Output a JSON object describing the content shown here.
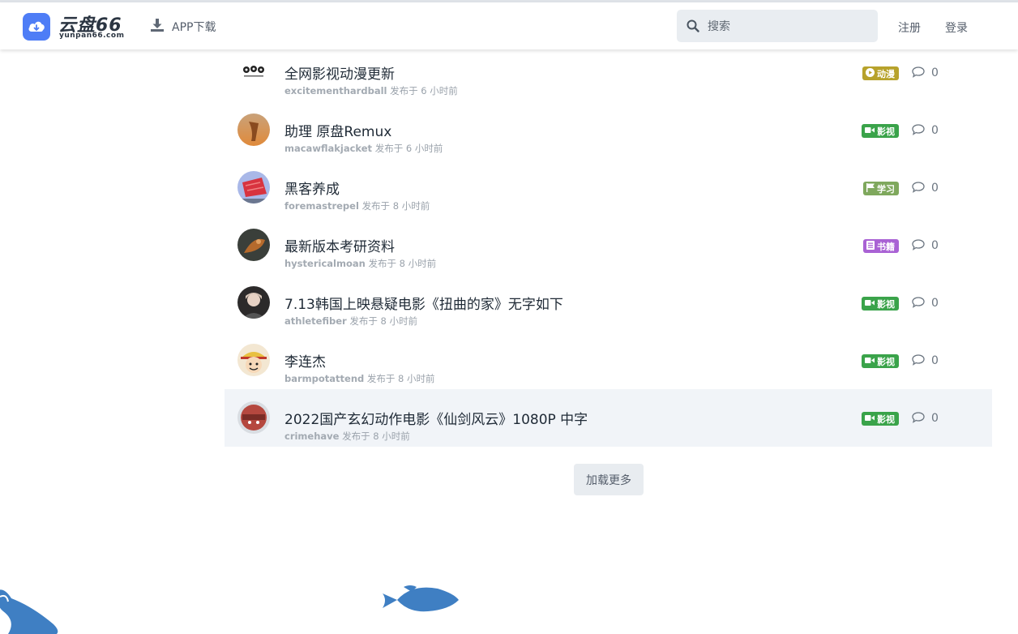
{
  "header": {
    "logo_main": "云盘66",
    "logo_sub": "yunpan66.com",
    "app_download": "APP下载",
    "search_placeholder": "搜索",
    "register": "注册",
    "login": "登录"
  },
  "posts": [
    {
      "title": "全网影视动漫更新",
      "user": "excitementhardball",
      "time": "发布于 6 小时前",
      "tag": "动漫",
      "tag_color": "#b7a22b",
      "tag_icon": "play-circle-icon",
      "comments": "0"
    },
    {
      "title": "助理 原盘Remux",
      "user": "macawflakjacket",
      "time": "发布于 6 小时前",
      "tag": "影视",
      "tag_color": "#3aa34a",
      "tag_icon": "video-camera-icon",
      "comments": "0"
    },
    {
      "title": "黑客养成",
      "user": "foremastrepel",
      "time": "发布于 8 小时前",
      "tag": "学习",
      "tag_color": "#7fa85d",
      "tag_icon": "flag-icon",
      "comments": "0"
    },
    {
      "title": "最新版本考研资料",
      "user": "hystericalmoan",
      "time": "发布于 8 小时前",
      "tag": "书籍",
      "tag_color": "#a962d4",
      "tag_icon": "book-icon",
      "comments": "0"
    },
    {
      "title": "7.13韩国上映悬疑电影《扭曲的家》无字如下",
      "user": "athletefiber",
      "time": "发布于 8 小时前",
      "tag": "影视",
      "tag_color": "#3aa34a",
      "tag_icon": "video-camera-icon",
      "comments": "0"
    },
    {
      "title": "李连杰",
      "user": "barmpotattend",
      "time": "发布于 8 小时前",
      "tag": "影视",
      "tag_color": "#3aa34a",
      "tag_icon": "video-camera-icon",
      "comments": "0"
    },
    {
      "title": "2022国产玄幻动作电影《仙剑风云》1080P 中字",
      "user": "crimehave",
      "time": "发布于 8 小时前",
      "tag": "影视",
      "tag_color": "#3aa34a",
      "tag_icon": "video-camera-icon",
      "comments": "0"
    }
  ],
  "load_more": "加载更多",
  "colors": {
    "brand": "#4e7df6",
    "decor_fish": "#3f7fc3"
  }
}
